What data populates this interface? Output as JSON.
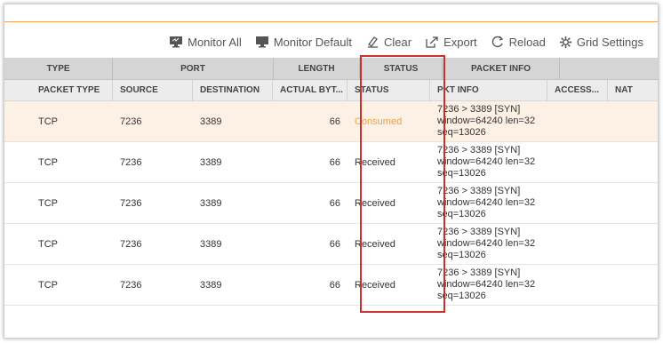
{
  "toolbar": {
    "monitor_all": "Monitor All",
    "monitor_default": "Monitor Default",
    "clear": "Clear",
    "export": "Export",
    "reload": "Reload",
    "grid_settings": "Grid Settings"
  },
  "group_headers": {
    "type": "TYPE",
    "port": "PORT",
    "length": "LENGTH",
    "status": "STATUS",
    "packet_info": "PACKET INFO"
  },
  "columns": {
    "packet_type": "PACKET TYPE",
    "source": "SOURCE",
    "destination": "DESTINATION",
    "actual_bytes": "ACTUAL BYT...",
    "status": "STATUS",
    "pkt_info": "PKT INFO",
    "access": "ACCESS...",
    "nat": "NAT"
  },
  "rows": [
    {
      "type": "TCP",
      "source": "7236",
      "destination": "3389",
      "bytes": "66",
      "status": "Consumed",
      "info1": "7236 > 3389 [SYN]",
      "info2": "window=64240 len=32",
      "info3": "seq=13026"
    },
    {
      "type": "TCP",
      "source": "7236",
      "destination": "3389",
      "bytes": "66",
      "status": "Received",
      "info1": "7236 > 3389 [SYN]",
      "info2": "window=64240 len=32",
      "info3": "seq=13026"
    },
    {
      "type": "TCP",
      "source": "7236",
      "destination": "3389",
      "bytes": "66",
      "status": "Received",
      "info1": "7236 > 3389 [SYN]",
      "info2": "window=64240 len=32",
      "info3": "seq=13026"
    },
    {
      "type": "TCP",
      "source": "7236",
      "destination": "3389",
      "bytes": "66",
      "status": "Received",
      "info1": "7236 > 3389 [SYN]",
      "info2": "window=64240 len=32",
      "info3": "seq=13026"
    },
    {
      "type": "TCP",
      "source": "7236",
      "destination": "3389",
      "bytes": "66",
      "status": "Received",
      "info1": "7236 > 3389 [SYN]",
      "info2": "window=64240 len=32",
      "info3": "seq=13026"
    }
  ],
  "colors": {
    "accent_orange": "#f2a15a",
    "consumed_text": "#e8a14a",
    "highlight_box": "#c8302c",
    "selected_row": "#fdf1e6"
  },
  "icons": [
    "monitor-all-icon",
    "monitor-default-icon",
    "clear-icon",
    "export-icon",
    "reload-icon",
    "grid-settings-icon"
  ]
}
